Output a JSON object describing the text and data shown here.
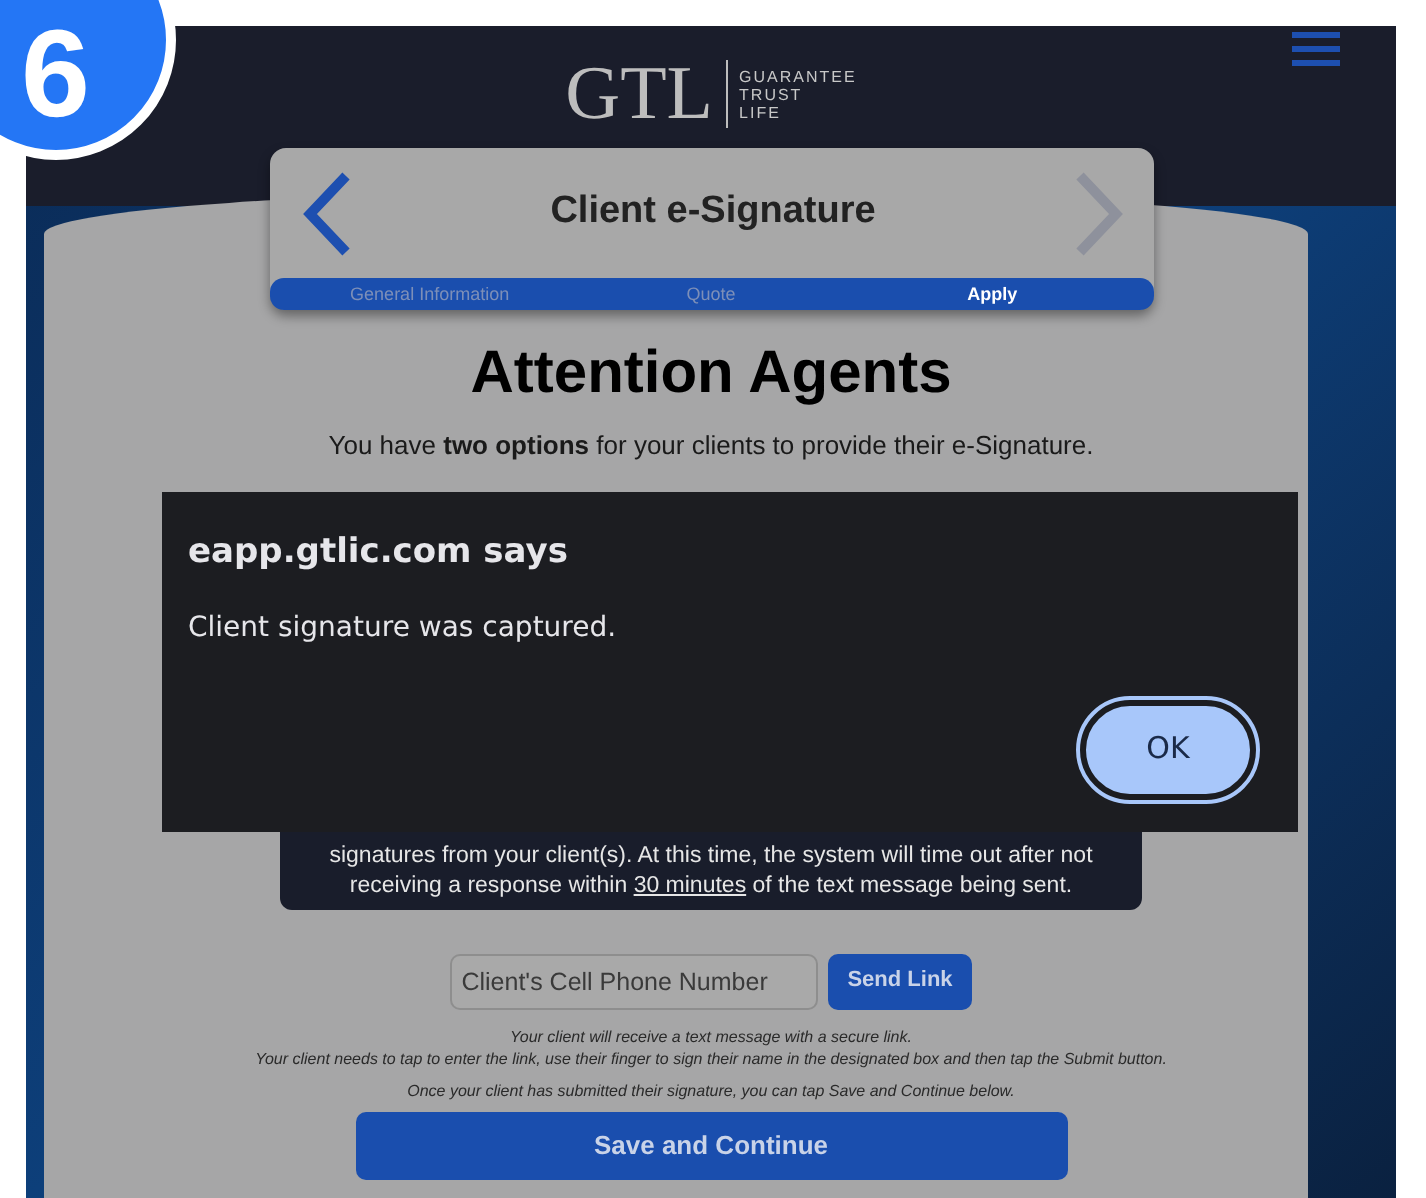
{
  "step_badge": "6",
  "header": {
    "logo_mark": "GTL",
    "logo_text": [
      "GUARANTEE",
      "TRUST",
      "LIFE"
    ]
  },
  "card": {
    "title": "Client e-Signature",
    "prev_enabled": true,
    "next_enabled": false,
    "steps": [
      {
        "label": "General Information",
        "selected": false
      },
      {
        "label": "Quote",
        "selected": false
      },
      {
        "label": "Apply",
        "selected": true
      }
    ]
  },
  "heading": "Attention Agents",
  "intro": "You have **two options** for your clients to provide their e-Signature.",
  "notice": {
    "before": "signatures from your client(s). At this time, the system will time out after not receiving a response within ",
    "underlined": "30 minutes",
    "after": " of the text message being sent."
  },
  "phone_field": {
    "placeholder": "Client's Cell Phone Number"
  },
  "send_button": "Send Link",
  "instructions": [
    "Your client will receive a text message with a secure link.",
    "Your client needs to tap to enter the link, use their finger to sign their name in the designated box and then tap the Submit button.",
    "Once your client has submitted their signature, you can tap Save and Continue below."
  ],
  "save_button": "Save and Continue",
  "dialog": {
    "title": "eapp.gtlic.com says",
    "message": "Client signature was captured.",
    "button": "OK"
  }
}
